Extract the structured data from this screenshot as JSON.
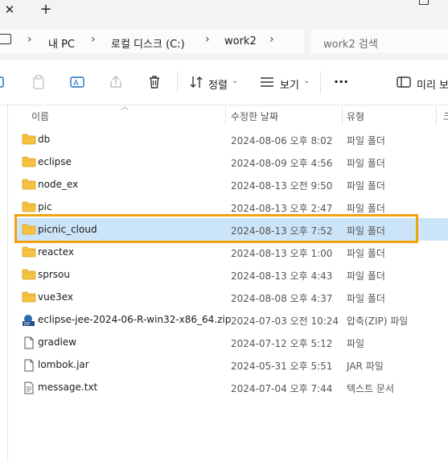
{
  "window": {
    "tab_close_glyph": "✕",
    "new_tab_glyph": "+"
  },
  "address": {
    "crumbs": [
      "내 PC",
      "로컬 디스크 (C:)",
      "work2"
    ],
    "separator": "›",
    "search_placeholder": "work2 검색"
  },
  "toolbar": {
    "sort_label": "정렬",
    "view_label": "보기",
    "more_glyph": "···",
    "preview_label": "미리 보"
  },
  "columns": {
    "name": "이름",
    "date": "수정한 날짜",
    "type": "유형",
    "size": "크"
  },
  "files": [
    {
      "name": "db",
      "date": "2024-08-06 오후 8:02",
      "type": "파일 폴더",
      "icon": "folder-icon"
    },
    {
      "name": "eclipse",
      "date": "2024-08-09 오후 4:56",
      "type": "파일 폴더",
      "icon": "folder-icon"
    },
    {
      "name": "node_ex",
      "date": "2024-08-13 오전 9:50",
      "type": "파일 폴더",
      "icon": "folder-icon"
    },
    {
      "name": "pic",
      "date": "2024-08-13 오후 2:47",
      "type": "파일 폴더",
      "icon": "folder-icon"
    },
    {
      "name": "picnic_cloud",
      "date": "2024-08-13 오후 7:52",
      "type": "파일 폴더",
      "icon": "folder-icon",
      "selected": true
    },
    {
      "name": "reactex",
      "date": "2024-08-13 오후 1:00",
      "type": "파일 폴더",
      "icon": "folder-icon"
    },
    {
      "name": "sprsou",
      "date": "2024-08-13 오후 4:43",
      "type": "파일 폴더",
      "icon": "folder-icon"
    },
    {
      "name": "vue3ex",
      "date": "2024-08-08 오후 4:37",
      "type": "파일 폴더",
      "icon": "folder-icon"
    },
    {
      "name": "eclipse-jee-2024-06-R-win32-x86_64.zip",
      "date": "2024-07-03 오전 10:24",
      "type": "압축(ZIP) 파일",
      "icon": "zip-icon"
    },
    {
      "name": "gradlew",
      "date": "2024-07-12 오후 5:12",
      "type": "파일",
      "icon": "file-icon"
    },
    {
      "name": "lombok.jar",
      "date": "2024-05-31 오후 5:51",
      "type": "JAR 파일",
      "icon": "file-icon"
    },
    {
      "name": "message.txt",
      "date": "2024-07-04 오후 7:44",
      "type": "텍스트 문서",
      "icon": "text-file-icon"
    }
  ],
  "colors": {
    "selection": "#cce4f7",
    "highlight": "#f0a30a",
    "folder": "#f5c242"
  }
}
